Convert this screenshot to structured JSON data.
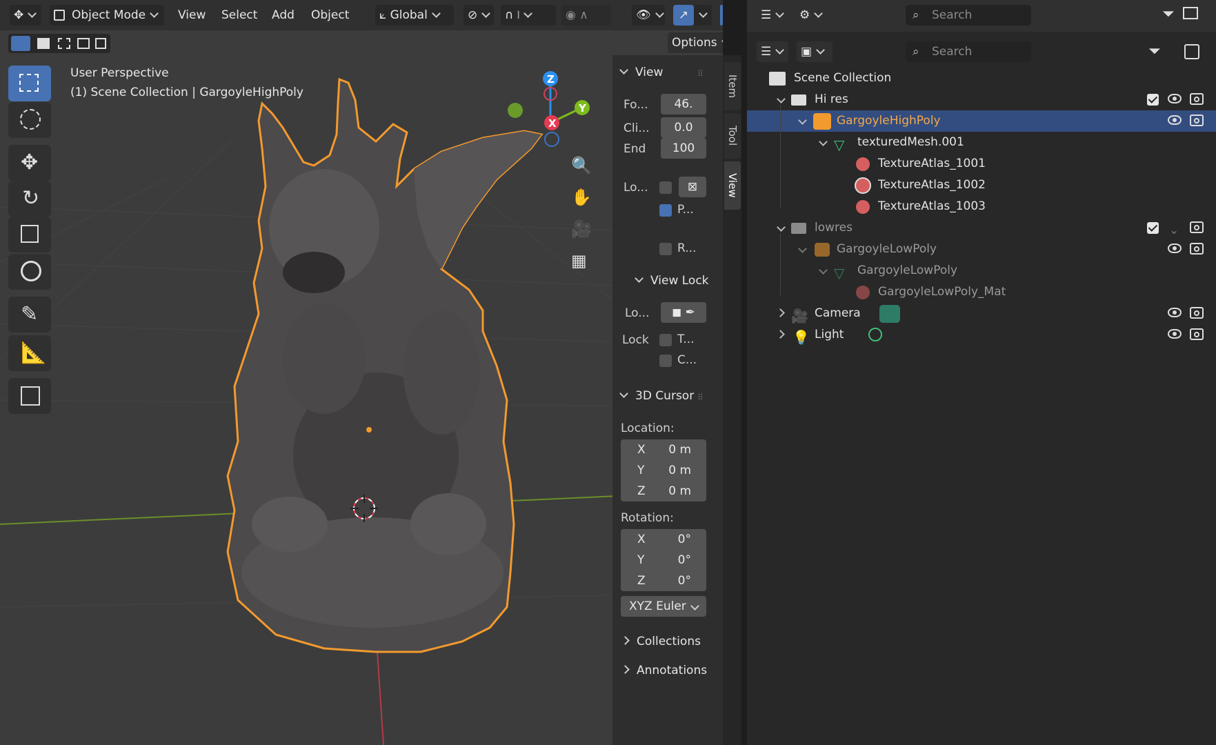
{
  "header": {
    "mode": "Object Mode",
    "menus": [
      "View",
      "Select",
      "Add",
      "Object"
    ],
    "transform_orientation": "Global",
    "options_label": "Options"
  },
  "viewport": {
    "perspective": "User Perspective",
    "context": "(1) Scene Collection | GargoyleHighPoly",
    "gizmo_axes": {
      "z": "Z",
      "y": "Y",
      "x": "X"
    }
  },
  "npanel": {
    "tabs": [
      "Item",
      "Tool",
      "View"
    ],
    "active_tab": "View",
    "view": {
      "title": "View",
      "focal_label": "Fo...",
      "focal_value": "46.",
      "clip_label": "Cli...",
      "clip_value": "0.0",
      "end_label": "End",
      "end_value": "100",
      "lock_label": "Lo...",
      "p_label": "P...",
      "r_label": "R..."
    },
    "view_lock": {
      "title": "View Lock",
      "lo_label": "Lo...",
      "lock_label": "Lock",
      "t_label": "T...",
      "c_label": "C..."
    },
    "cursor": {
      "title": "3D Cursor",
      "location_label": "Location:",
      "location": [
        {
          "axis": "X",
          "value": "0 m"
        },
        {
          "axis": "Y",
          "value": "0 m"
        },
        {
          "axis": "Z",
          "value": "0 m"
        }
      ],
      "rotation_label": "Rotation:",
      "rotation": [
        {
          "axis": "X",
          "value": "0°"
        },
        {
          "axis": "Y",
          "value": "0°"
        },
        {
          "axis": "Z",
          "value": "0°"
        }
      ],
      "rotation_mode": "XYZ Euler"
    },
    "collections_title": "Collections",
    "annotations_title": "Annotations"
  },
  "outliner": {
    "search_placeholder_top": "Search",
    "search_placeholder": "Search",
    "rows": {
      "scene": "Scene Collection",
      "hires": "Hi res",
      "gargoyle_high": "GargoyleHighPoly",
      "textured_mesh": "texturedMesh.001",
      "atlas1": "TextureAtlas_1001",
      "atlas2": "TextureAtlas_1002",
      "atlas3": "TextureAtlas_1003",
      "lowres": "lowres",
      "gargoyle_low": "GargoyleLowPoly",
      "gargoyle_low_mesh": "GargoyleLowPoly",
      "gargoyle_low_mat": "GargoyleLowPoly_Mat",
      "camera": "Camera",
      "light": "Light"
    }
  },
  "colors": {
    "accent": "#4772b3",
    "selected_row": "#334d80",
    "selection_outline": "#f39a2e",
    "axis_x": "#e83a52",
    "axis_y": "#7dbb1e",
    "axis_z": "#2c8ff0"
  }
}
